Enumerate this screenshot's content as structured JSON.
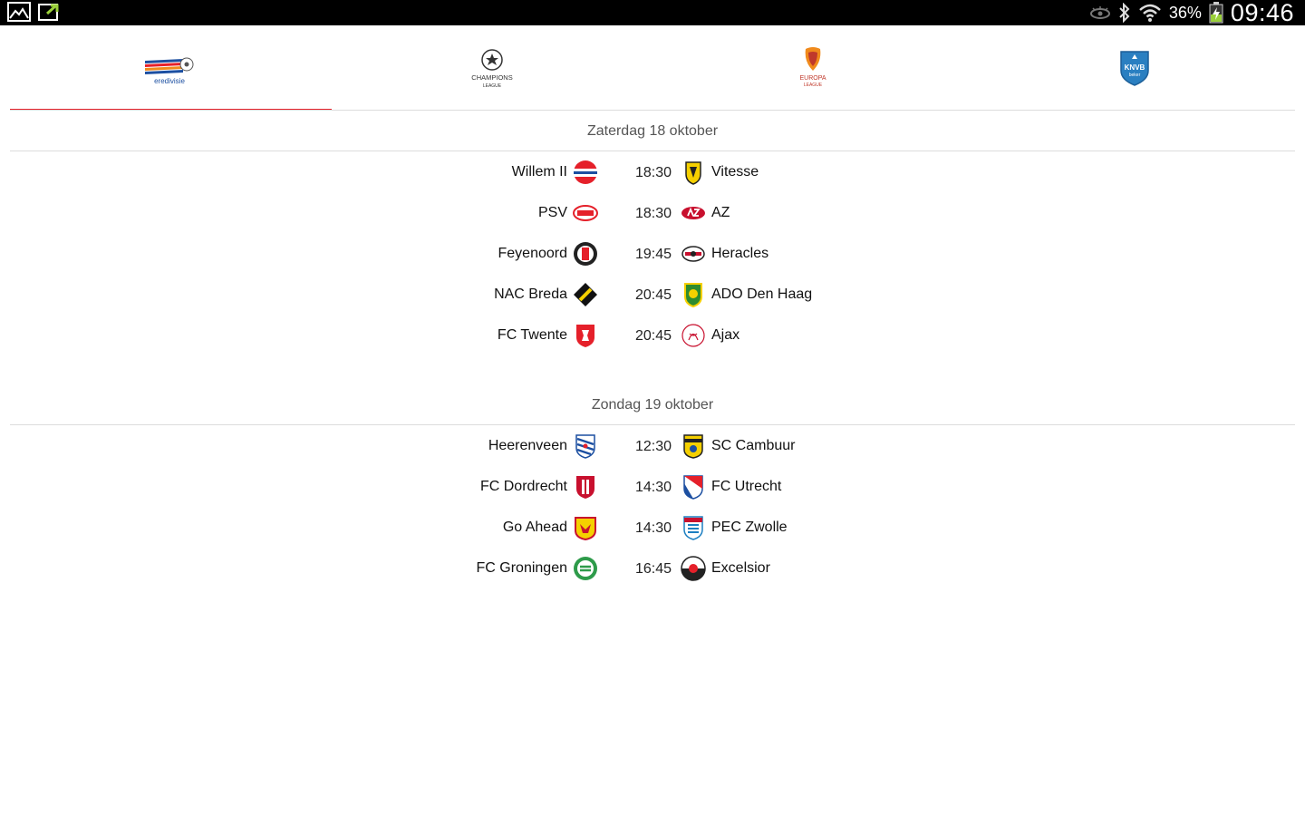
{
  "status_bar": {
    "battery_percent": "36%",
    "time": "09:46"
  },
  "tabs": [
    {
      "label": "eredivisie",
      "active": true
    },
    {
      "label": "CHAMPIONS LEAGUE",
      "active": false
    },
    {
      "label": "EUROPA LEAGUE",
      "active": false
    },
    {
      "label": "KNVB beker",
      "active": false
    }
  ],
  "days": [
    {
      "title": "Zaterdag 18 oktober",
      "matches": [
        {
          "home": "Willem II",
          "time": "18:30",
          "away": "Vitesse"
        },
        {
          "home": "PSV",
          "time": "18:30",
          "away": "AZ"
        },
        {
          "home": "Feyenoord",
          "time": "19:45",
          "away": "Heracles"
        },
        {
          "home": "NAC Breda",
          "time": "20:45",
          "away": "ADO Den Haag"
        },
        {
          "home": "FC Twente",
          "time": "20:45",
          "away": "Ajax"
        }
      ]
    },
    {
      "title": "Zondag 19 oktober",
      "matches": [
        {
          "home": "Heerenveen",
          "time": "12:30",
          "away": "SC Cambuur"
        },
        {
          "home": "FC Dordrecht",
          "time": "14:30",
          "away": "FC Utrecht"
        },
        {
          "home": "Go Ahead",
          "time": "14:30",
          "away": "PEC Zwolle"
        },
        {
          "home": "FC Groningen",
          "time": "16:45",
          "away": "Excelsior"
        }
      ]
    }
  ],
  "colors": {
    "accent": "#e5202a",
    "status_bar_bg": "#000000",
    "divider": "#dddddd"
  }
}
